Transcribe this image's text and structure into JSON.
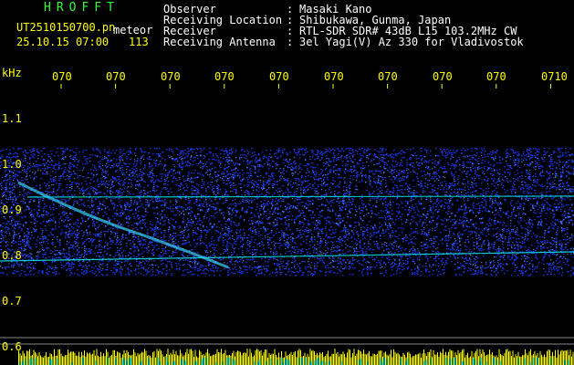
{
  "header": {
    "brand": "HROFFT",
    "filename": "UT2510150700.pn",
    "kind": "meteor",
    "datetime": "25.10.15 07:00",
    "count": "113"
  },
  "info": [
    {
      "label": "Observer",
      "value": "Masaki Kano"
    },
    {
      "label": "Receiving Location",
      "value": "Shibukawa, Gunma, Japan"
    },
    {
      "label": "Receiver",
      "value": "RTL-SDR SDR# 43dB L15 103.2MHz CW"
    },
    {
      "label": "Receiving Antenna",
      "value": "3el Yagi(V) Az 330 for Vladivostok"
    }
  ],
  "axis": {
    "unit": "kHz",
    "y_ticks": [
      "1.1",
      "1.0",
      "0.9",
      "0.8",
      "0.7",
      "0.6"
    ],
    "x_ticks": [
      "070",
      "070",
      "070",
      "070",
      "070",
      "070",
      "070",
      "070",
      "070",
      "0710"
    ]
  },
  "colors": {
    "header_green": "#33ff33",
    "text_white": "#ffffff",
    "axis_yellow": "#ffff00",
    "signal_cyan": "#00ffff",
    "noise_blue": "#1a3cff"
  }
}
